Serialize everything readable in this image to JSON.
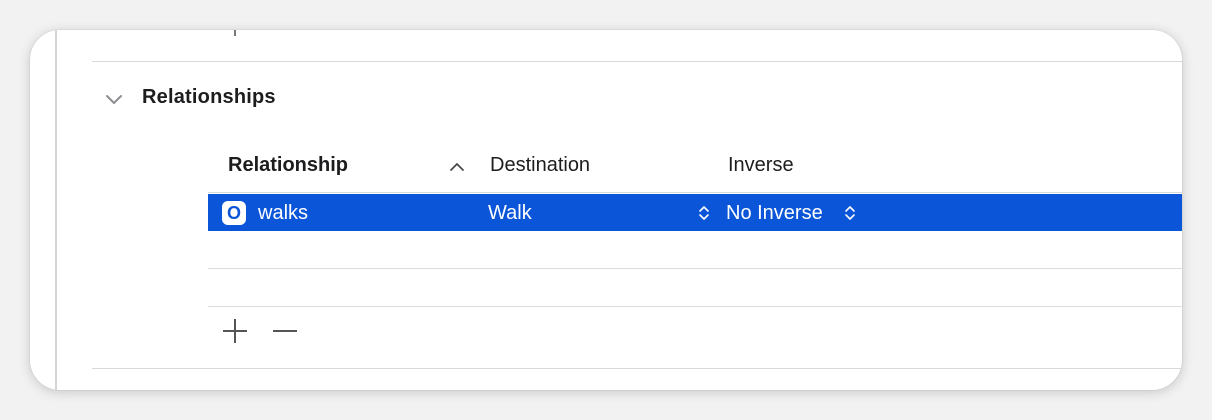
{
  "section": {
    "title": "Relationships",
    "disclosure_icon": "chevron-down-icon"
  },
  "table": {
    "columns": [
      {
        "label": "Relationship",
        "sorted": "ascending"
      },
      {
        "label": "Destination"
      },
      {
        "label": "Inverse"
      }
    ],
    "rows": [
      {
        "badge": "O",
        "name": "walks",
        "destination": "Walk",
        "inverse": "No Inverse",
        "selected": true
      }
    ]
  },
  "toolbar": {
    "add_icon": "plus-icon",
    "remove_icon": "minus-icon"
  },
  "colors": {
    "selection": "#0a55d8",
    "background": "#ffffff",
    "separator": "#d9d9d9"
  }
}
